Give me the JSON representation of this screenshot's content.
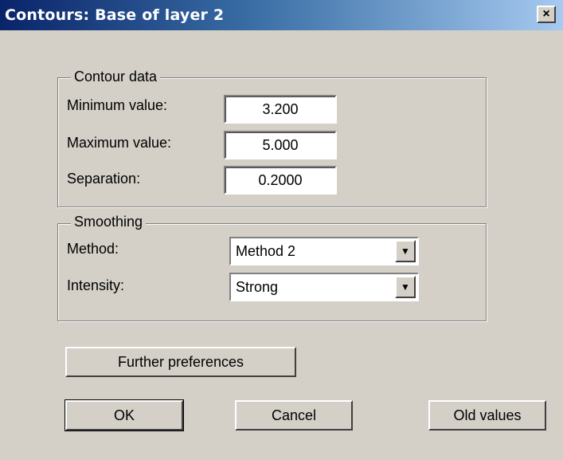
{
  "window": {
    "title": "Contours:  Base of layer 2",
    "close_glyph": "×",
    "close_icon": "close-icon"
  },
  "contour_data": {
    "legend": "Contour data",
    "min_label": "Minimum value:",
    "min_value": "3.200",
    "max_label": "Maximum value:",
    "max_value": "5.000",
    "sep_label": "Separation:",
    "sep_value": "0.2000"
  },
  "smoothing": {
    "legend": "Smoothing",
    "method_label": "Method:",
    "method_value": "Method 2",
    "intensity_label": "Intensity:",
    "intensity_value": "Strong",
    "dropdown_glyph": "▼"
  },
  "buttons": {
    "further": "Further preferences",
    "ok": "OK",
    "cancel": "Cancel",
    "old_values": "Old values"
  }
}
